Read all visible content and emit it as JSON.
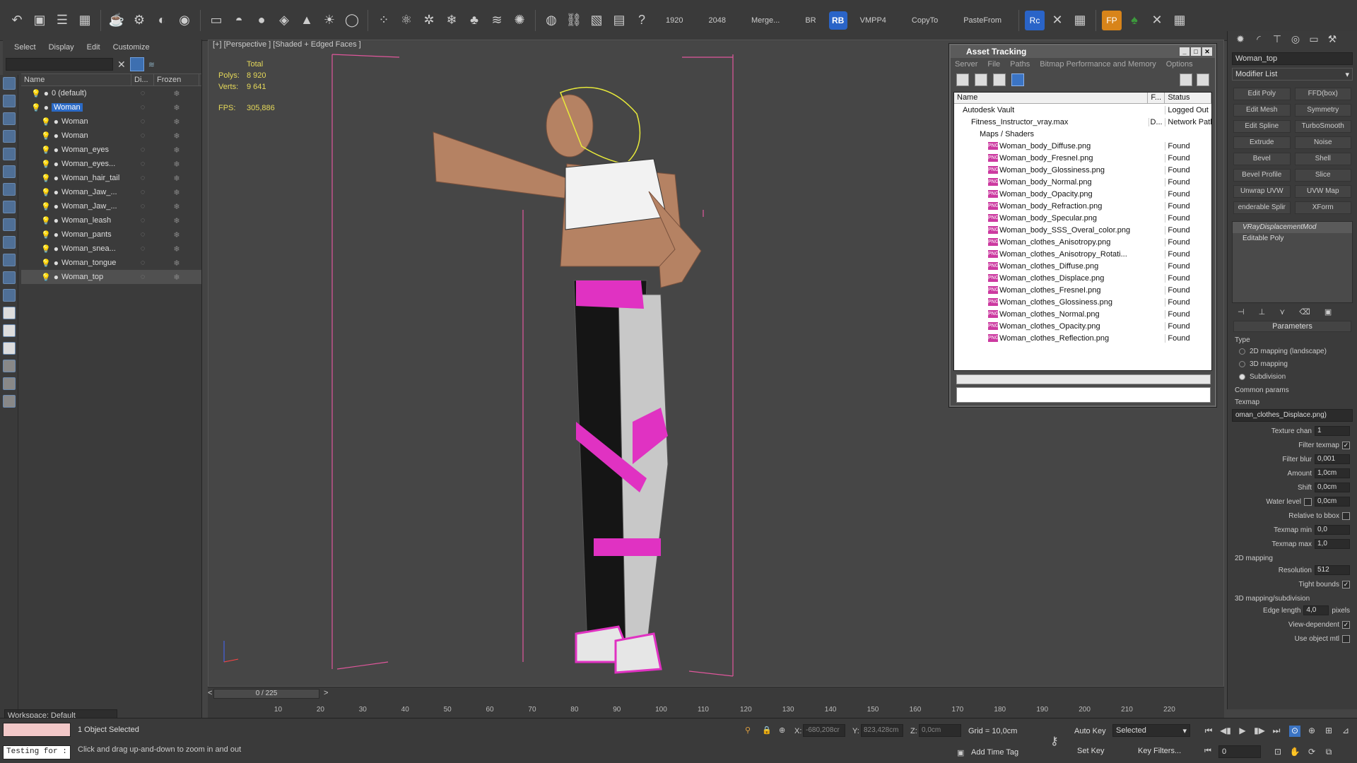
{
  "toolbar": {
    "items": [
      "1920",
      "2048",
      "Merge...",
      "BR",
      "RB",
      "VMPP4",
      "CopyTo",
      "PasteFrom"
    ]
  },
  "scene_explorer": {
    "menu": [
      "Select",
      "Display",
      "Edit",
      "Customize"
    ],
    "columns": [
      "Name",
      "Di...",
      "Frozen"
    ],
    "rows": [
      {
        "name": "0 (default)",
        "selected": false
      },
      {
        "name": "Woman",
        "selected": true
      },
      {
        "name": "Woman",
        "selected": false
      },
      {
        "name": "Woman",
        "selected": false
      },
      {
        "name": "Woman_eyes",
        "selected": false
      },
      {
        "name": "Woman_eyes...",
        "selected": false
      },
      {
        "name": "Woman_hair_tail",
        "selected": false
      },
      {
        "name": "Woman_Jaw_...",
        "selected": false
      },
      {
        "name": "Woman_Jaw_...",
        "selected": false
      },
      {
        "name": "Woman_leash",
        "selected": false
      },
      {
        "name": "Woman_pants",
        "selected": false
      },
      {
        "name": "Woman_snea...",
        "selected": false
      },
      {
        "name": "Woman_tongue",
        "selected": false
      },
      {
        "name": "Woman_top",
        "selected": false
      }
    ],
    "workspace": "Workspace: Default"
  },
  "viewport": {
    "label": "[+] [Perspective ] [Shaded + Edged Faces ]",
    "stats": {
      "total": "Total",
      "polys_label": "Polys:",
      "polys": "8 920",
      "verts_label": "Verts:",
      "verts": "9 641",
      "fps_label": "FPS:",
      "fps": "305,886"
    }
  },
  "asset_tracking": {
    "title": "Asset Tracking",
    "menu": [
      "Server",
      "File",
      "Paths",
      "Bitmap Performance and Memory",
      "Options"
    ],
    "columns": [
      "Name",
      "F...",
      "Status"
    ],
    "rows": [
      {
        "name": "Autodesk Vault",
        "f": "",
        "status": "Logged Out",
        "indent": 1,
        "png": false
      },
      {
        "name": "Fitness_Instructor_vray.max",
        "f": "D...",
        "status": "Network Path",
        "indent": 2,
        "png": false
      },
      {
        "name": "Maps / Shaders",
        "f": "",
        "status": "",
        "indent": 3,
        "png": false
      },
      {
        "name": "Woman_body_Diffuse.png",
        "f": "",
        "status": "Found",
        "indent": 4,
        "png": true
      },
      {
        "name": "Woman_body_FresneI.png",
        "f": "",
        "status": "Found",
        "indent": 4,
        "png": true
      },
      {
        "name": "Woman_body_Glossiness.png",
        "f": "",
        "status": "Found",
        "indent": 4,
        "png": true
      },
      {
        "name": "Woman_body_Normal.png",
        "f": "",
        "status": "Found",
        "indent": 4,
        "png": true
      },
      {
        "name": "Woman_body_Opacity.png",
        "f": "",
        "status": "Found",
        "indent": 4,
        "png": true
      },
      {
        "name": "Woman_body_Refraction.png",
        "f": "",
        "status": "Found",
        "indent": 4,
        "png": true
      },
      {
        "name": "Woman_body_Specular.png",
        "f": "",
        "status": "Found",
        "indent": 4,
        "png": true
      },
      {
        "name": "Woman_body_SSS_Overal_color.png",
        "f": "",
        "status": "Found",
        "indent": 4,
        "png": true
      },
      {
        "name": "Woman_clothes_Anisotropy.png",
        "f": "",
        "status": "Found",
        "indent": 4,
        "png": true
      },
      {
        "name": "Woman_clothes_Anisotropy_Rotati...",
        "f": "",
        "status": "Found",
        "indent": 4,
        "png": true
      },
      {
        "name": "Woman_clothes_Diffuse.png",
        "f": "",
        "status": "Found",
        "indent": 4,
        "png": true
      },
      {
        "name": "Woman_clothes_Displace.png",
        "f": "",
        "status": "Found",
        "indent": 4,
        "png": true
      },
      {
        "name": "Woman_clothes_FresneI.png",
        "f": "",
        "status": "Found",
        "indent": 4,
        "png": true
      },
      {
        "name": "Woman_clothes_Glossiness.png",
        "f": "",
        "status": "Found",
        "indent": 4,
        "png": true
      },
      {
        "name": "Woman_clothes_Normal.png",
        "f": "",
        "status": "Found",
        "indent": 4,
        "png": true
      },
      {
        "name": "Woman_clothes_Opacity.png",
        "f": "",
        "status": "Found",
        "indent": 4,
        "png": true
      },
      {
        "name": "Woman_clothes_Reflection.png",
        "f": "",
        "status": "Found",
        "indent": 4,
        "png": true
      }
    ]
  },
  "command_panel": {
    "object_name": "Woman_top",
    "modifier_list": "Modifier List",
    "buttons": [
      "Edit Poly",
      "FFD(box)",
      "Edit Mesh",
      "Symmetry",
      "Edit Spline",
      "TurboSmooth",
      "Extrude",
      "Noise",
      "Bevel",
      "Shell",
      "Bevel Profile",
      "Slice",
      "Unwrap UVW",
      "UVW Map",
      "enderable Splir",
      "XForm"
    ],
    "stack": [
      "VRayDisplacementMod",
      "Editable Poly"
    ],
    "parameters_title": "Parameters",
    "type_label": "Type",
    "type_options": [
      {
        "label": "2D mapping (landscape)",
        "on": false
      },
      {
        "label": "3D mapping",
        "on": false
      },
      {
        "label": "Subdivision",
        "on": true
      }
    ],
    "common_params": "Common params",
    "texmap_label": "Texmap",
    "texmap_value": "oman_clothes_Displace.png)",
    "texture_chan_label": "Texture chan",
    "texture_chan": "1",
    "filter_texmap_label": "Filter texmap",
    "filter_blur_label": "Filter blur",
    "filter_blur": "0,001",
    "amount_label": "Amount",
    "amount": "1,0cm",
    "shift_label": "Shift",
    "shift": "0,0cm",
    "water_level_label": "Water level",
    "water_level": "0,0cm",
    "relative_bbox_label": "Relative to bbox",
    "texmap_min_label": "Texmap min",
    "texmap_min": "0,0",
    "texmap_max_label": "Texmap max",
    "texmap_max": "1,0",
    "mapping_2d": "2D mapping",
    "resolution_label": "Resolution",
    "resolution": "512",
    "tight_bounds_label": "Tight bounds",
    "mapping_3d": "3D mapping/subdivision",
    "edge_length_label": "Edge length",
    "edge_length": "4,0",
    "pixels_label": "pixels",
    "view_dependent_label": "View-dependent",
    "use_object_mtl_label": "Use object mtl"
  },
  "timeline": {
    "frame_label": "0 / 225",
    "ticks": [
      "10",
      "20",
      "30",
      "40",
      "50",
      "60",
      "70",
      "80",
      "90",
      "100",
      "110",
      "120",
      "130",
      "140",
      "150",
      "160",
      "170",
      "180",
      "190",
      "200",
      "210",
      "220"
    ]
  },
  "status": {
    "maxscript_text": "Testing for :",
    "selected": "1 Object Selected",
    "prompt": "Click and drag up-and-down to zoom in and out",
    "x_label": "X:",
    "x": "-680,208cr",
    "y_label": "Y:",
    "y": "823,428cm",
    "z_label": "Z:",
    "z": "0,0cm",
    "grid": "Grid = 10,0cm",
    "add_time_tag": "Add Time Tag",
    "auto_key": "Auto Key",
    "set_key": "Set Key",
    "selected_dd": "Selected",
    "key_filters": "Key Filters...",
    "frame": "0"
  }
}
